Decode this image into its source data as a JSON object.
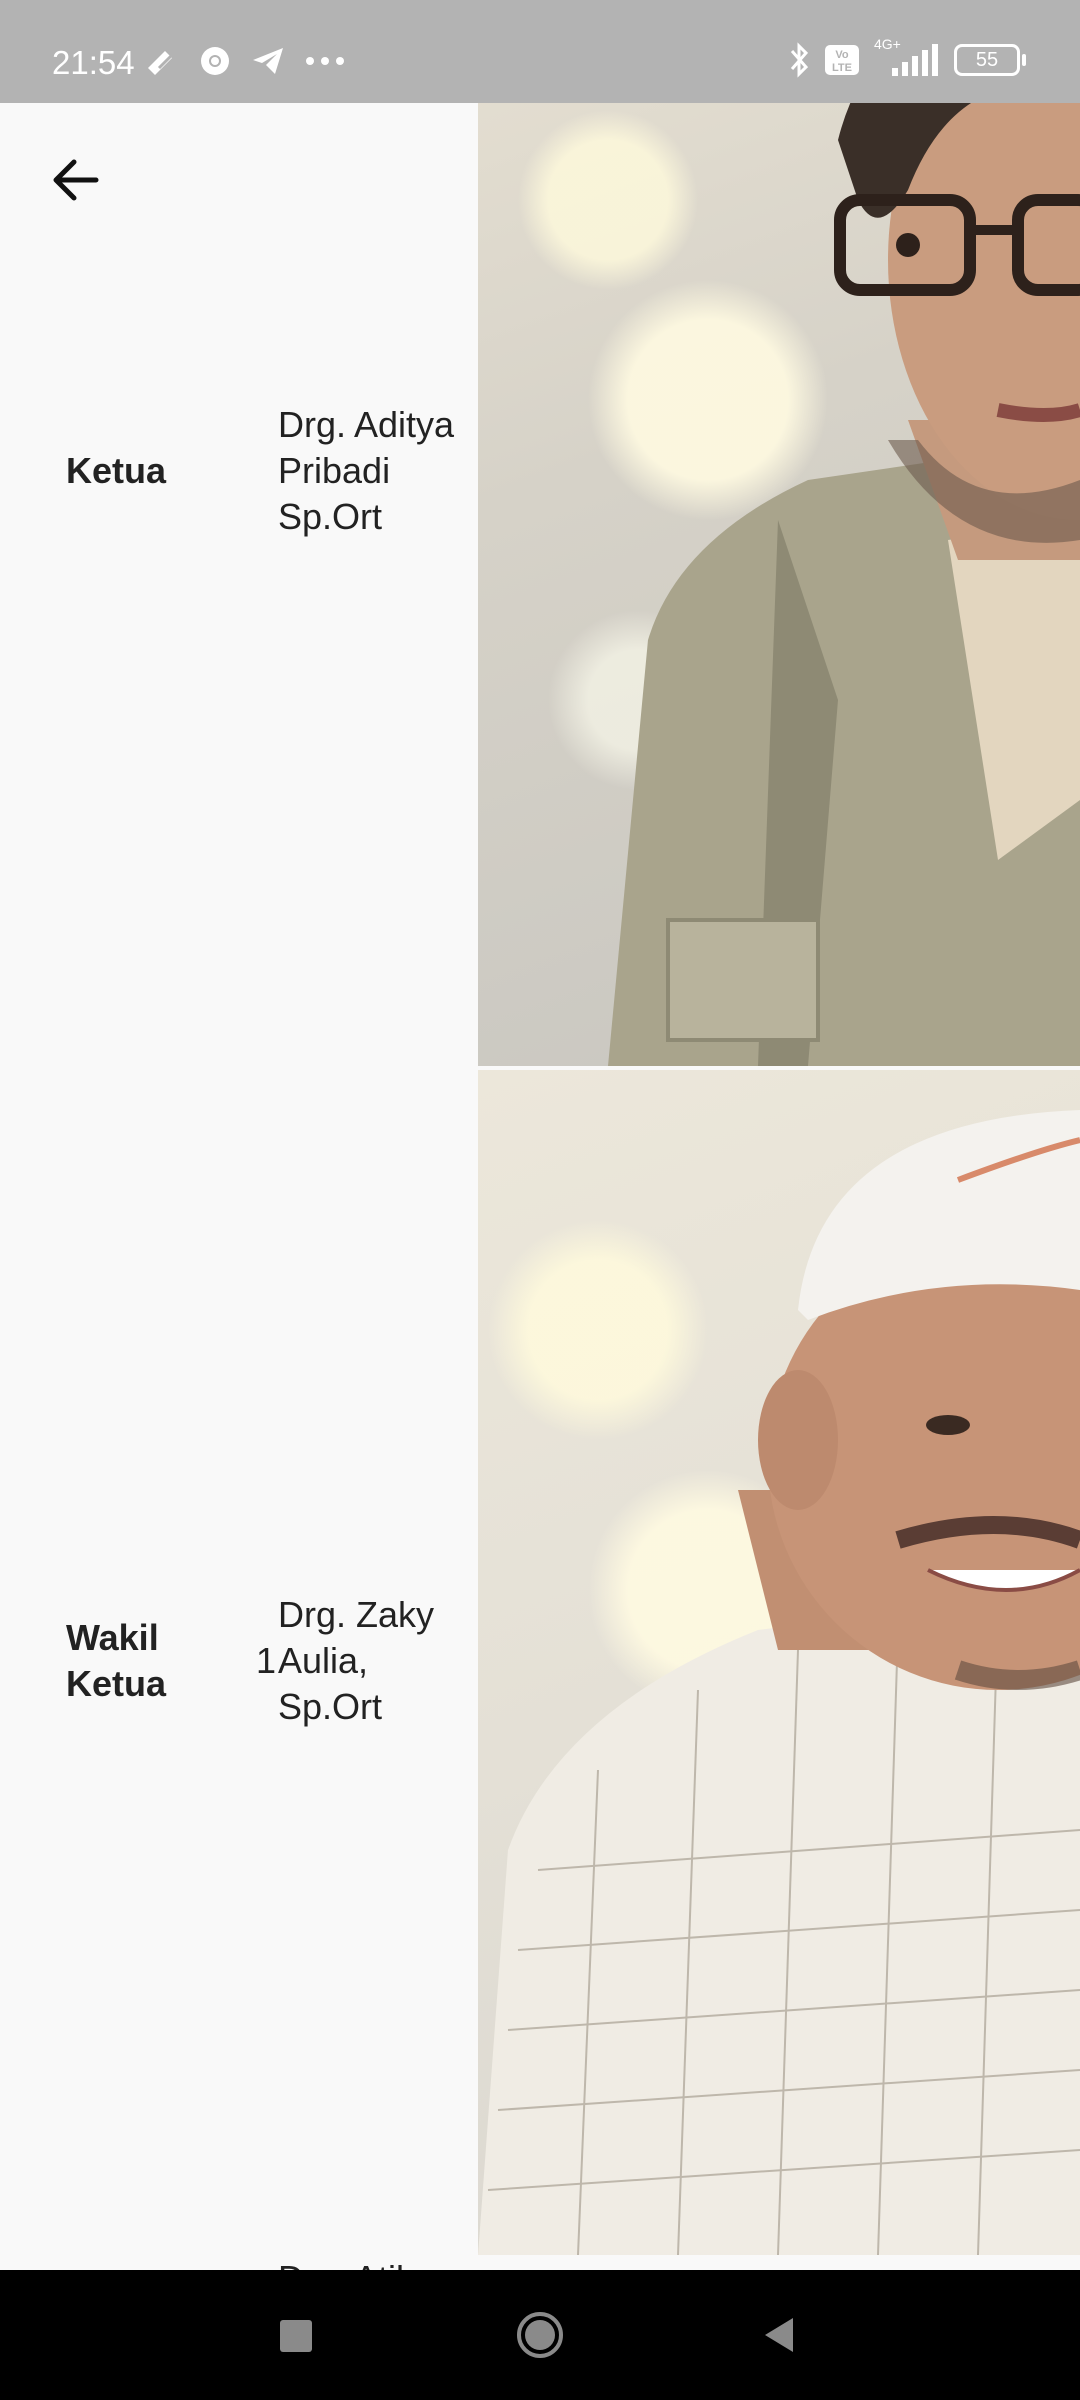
{
  "status_bar": {
    "time": "21:54",
    "battery": "55",
    "left_icons": [
      "stylus-icon",
      "chrome-icon",
      "telegram-icon",
      "more-dots-icon"
    ],
    "right_icons": [
      "bluetooth-icon",
      "volte-icon",
      "signal-4g-icon",
      "battery-icon"
    ],
    "network_label": "4G+"
  },
  "toolbar": {
    "back_icon": "arrow-left-icon"
  },
  "rows": [
    {
      "role": "Ketua",
      "number": "",
      "name": "Drg. Aditya Pribadi Sp.Ort"
    },
    {
      "role": "Wakil Ketua",
      "number": "1",
      "name": "Drg. Zaky Aulia, Sp.Ort"
    }
  ],
  "next_row_partial": "Drg. Atik",
  "nav_bar": {
    "buttons": [
      "recents-square-icon",
      "home-circle-icon",
      "back-triangle-icon"
    ]
  }
}
